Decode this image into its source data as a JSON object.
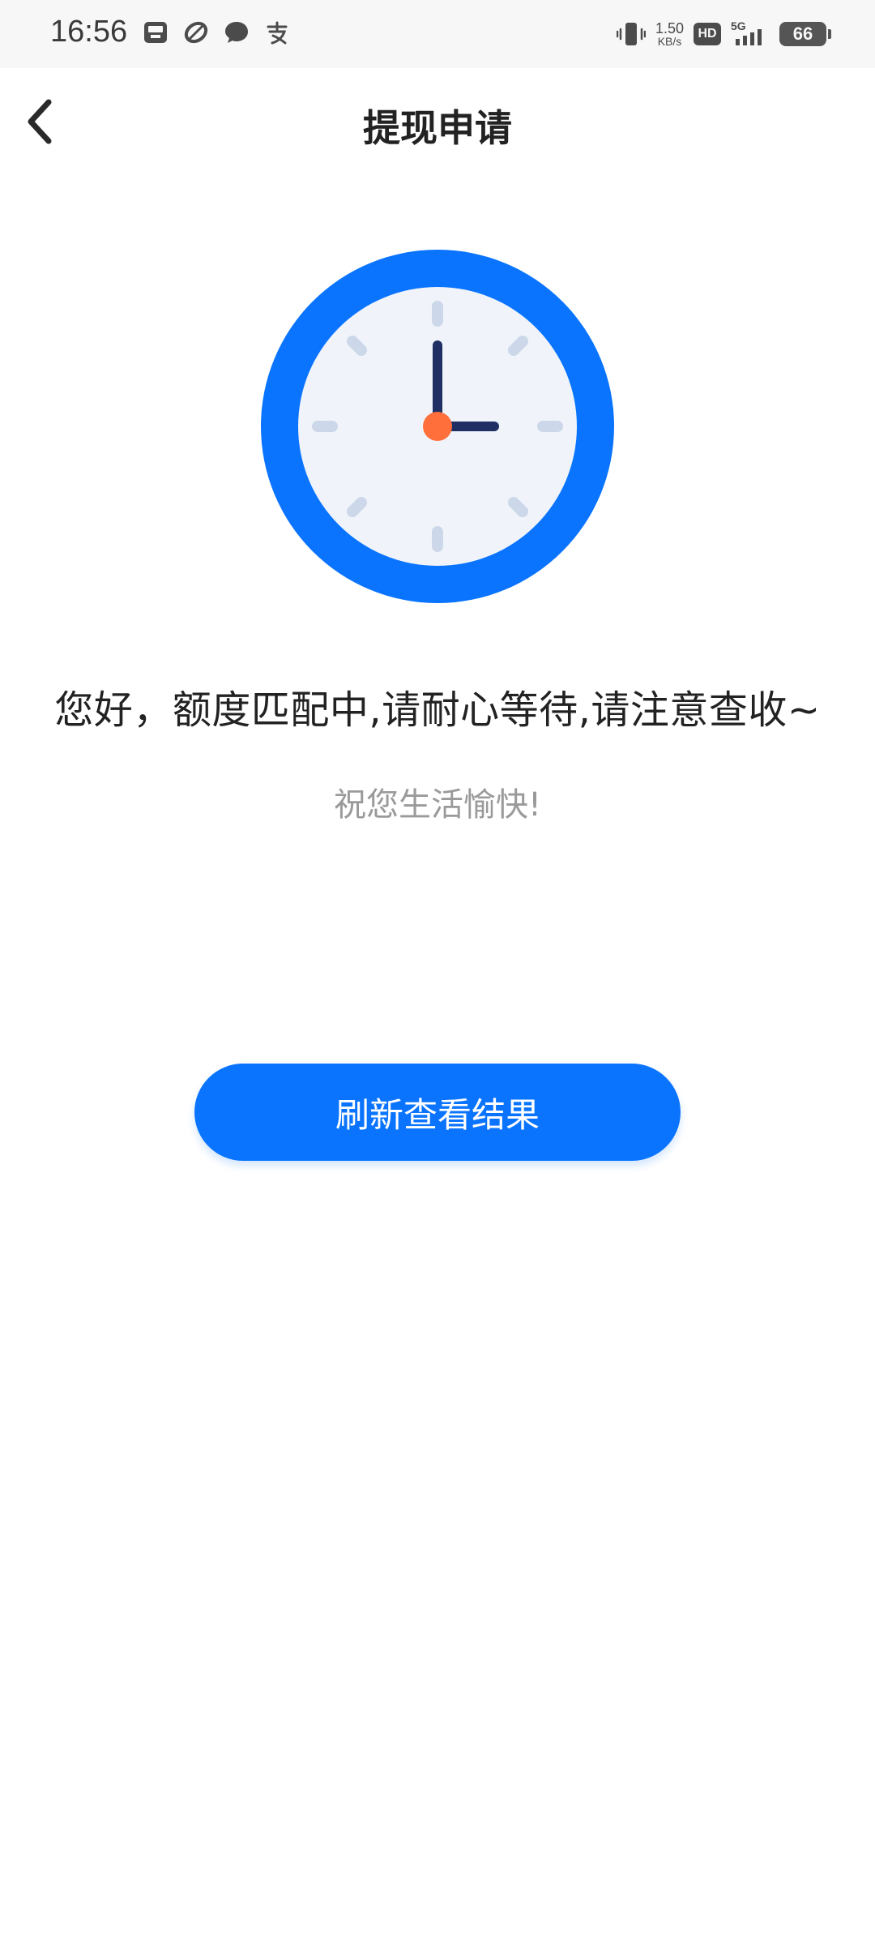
{
  "status_bar": {
    "time": "16:56",
    "net_speed_value": "1.50",
    "net_speed_unit": "KB/s",
    "hd_label": "HD",
    "network_label": "5G",
    "battery_level": "66",
    "left_icons": [
      "inbox-icon",
      "swirl-app-icon",
      "chat-bubble-icon",
      "alipay-icon"
    ]
  },
  "header": {
    "title": "提现申请",
    "back_icon": "chevron-left-icon"
  },
  "main": {
    "clock_icon": "clock-icon",
    "message": "您好，额度匹配中,请耐心等待,请注意查收~",
    "sub_message": "祝您生活愉快!",
    "refresh_button_label": "刷新查看结果"
  },
  "colors": {
    "accent": "#0a74ff",
    "clock_face": "#f0f4fa",
    "clock_hand": "#1f2f63",
    "clock_center": "#ff6f3c",
    "tick": "#cdd7ea"
  }
}
